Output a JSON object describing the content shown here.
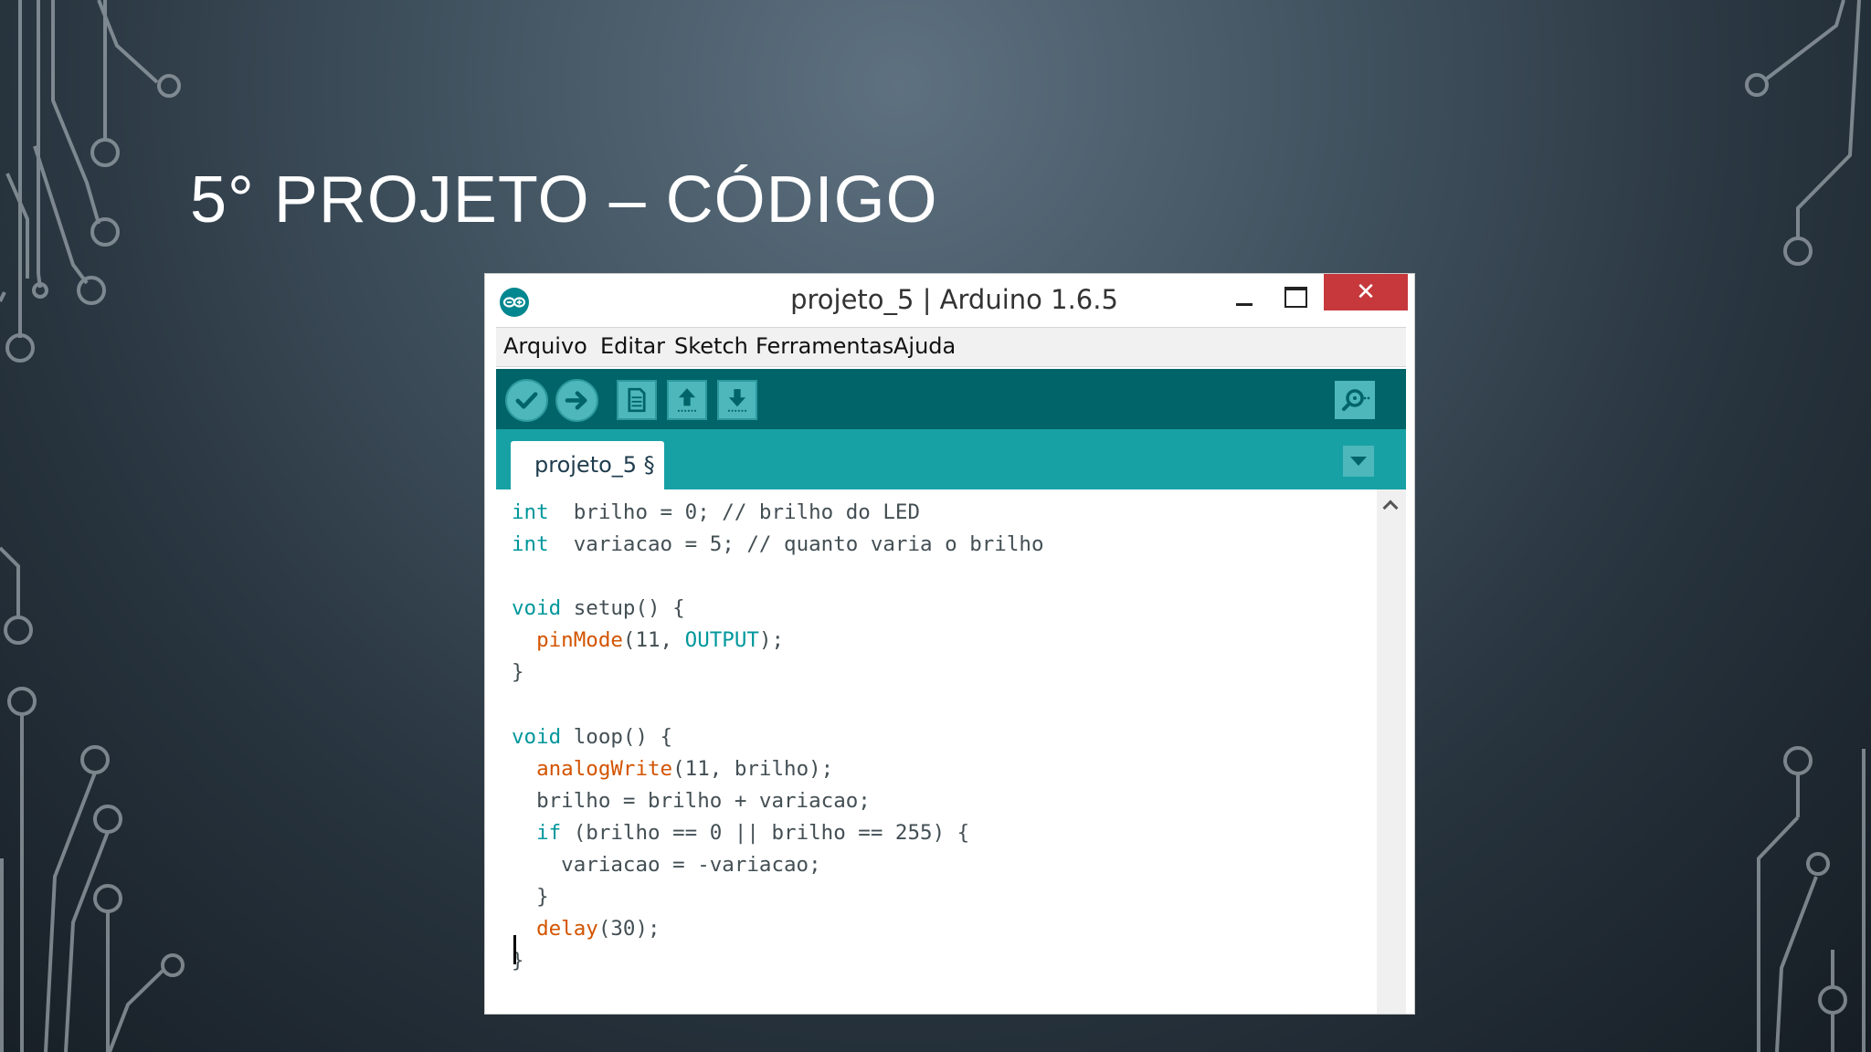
{
  "slide": {
    "title": "5° PROJETO – CÓDIGO"
  },
  "window": {
    "title": "projeto_5 | Arduino 1.6.5",
    "close_glyph": "✕"
  },
  "menu": {
    "items": [
      "Arquivo",
      "Editar",
      "Sketch",
      "Ferramentas",
      "Ajuda"
    ]
  },
  "toolbar": {
    "buttons": [
      "verify",
      "upload",
      "new",
      "open",
      "save",
      "serial-monitor"
    ]
  },
  "tabs": [
    {
      "label": "projeto_5 §"
    }
  ],
  "editor": {
    "lines": [
      [
        [
          "kw",
          "int"
        ],
        [
          "",
          "  brilho = 0; // brilho do LED"
        ]
      ],
      [
        [
          "kw",
          "int"
        ],
        [
          "",
          "  variacao = 5; // quanto varia o brilho"
        ]
      ],
      [],
      [
        [
          "kw",
          "void"
        ],
        [
          "",
          " setup() {"
        ]
      ],
      [
        [
          "",
          ""
        ],
        [
          "fn",
          "  pinMode"
        ],
        [
          "",
          "(11, "
        ],
        [
          "kw",
          "OUTPUT"
        ],
        [
          "",
          ");"
        ]
      ],
      [
        [
          "",
          "}"
        ]
      ],
      [],
      [
        [
          "kw",
          "void"
        ],
        [
          "",
          " loop() {"
        ]
      ],
      [
        [
          "fn",
          "  analogWrite"
        ],
        [
          "",
          "(11, brilho);"
        ]
      ],
      [
        [
          "",
          "  brilho = brilho + variacao;"
        ]
      ],
      [
        [
          "kw",
          "  if"
        ],
        [
          "",
          " (brilho == 0 || brilho == 255) {"
        ]
      ],
      [
        [
          "",
          "    variacao = -variacao;"
        ]
      ],
      [
        [
          "",
          "  }"
        ]
      ],
      [
        [
          "fn",
          "  delay"
        ],
        [
          "",
          "(30);"
        ]
      ],
      [
        [
          "",
          "}"
        ]
      ]
    ]
  },
  "colors": {
    "toolbar": "#006468",
    "tabbar": "#17a1a5",
    "button": "#4db7bb",
    "keyword": "#00979c",
    "function": "#d35400",
    "close": "#c7383d"
  }
}
